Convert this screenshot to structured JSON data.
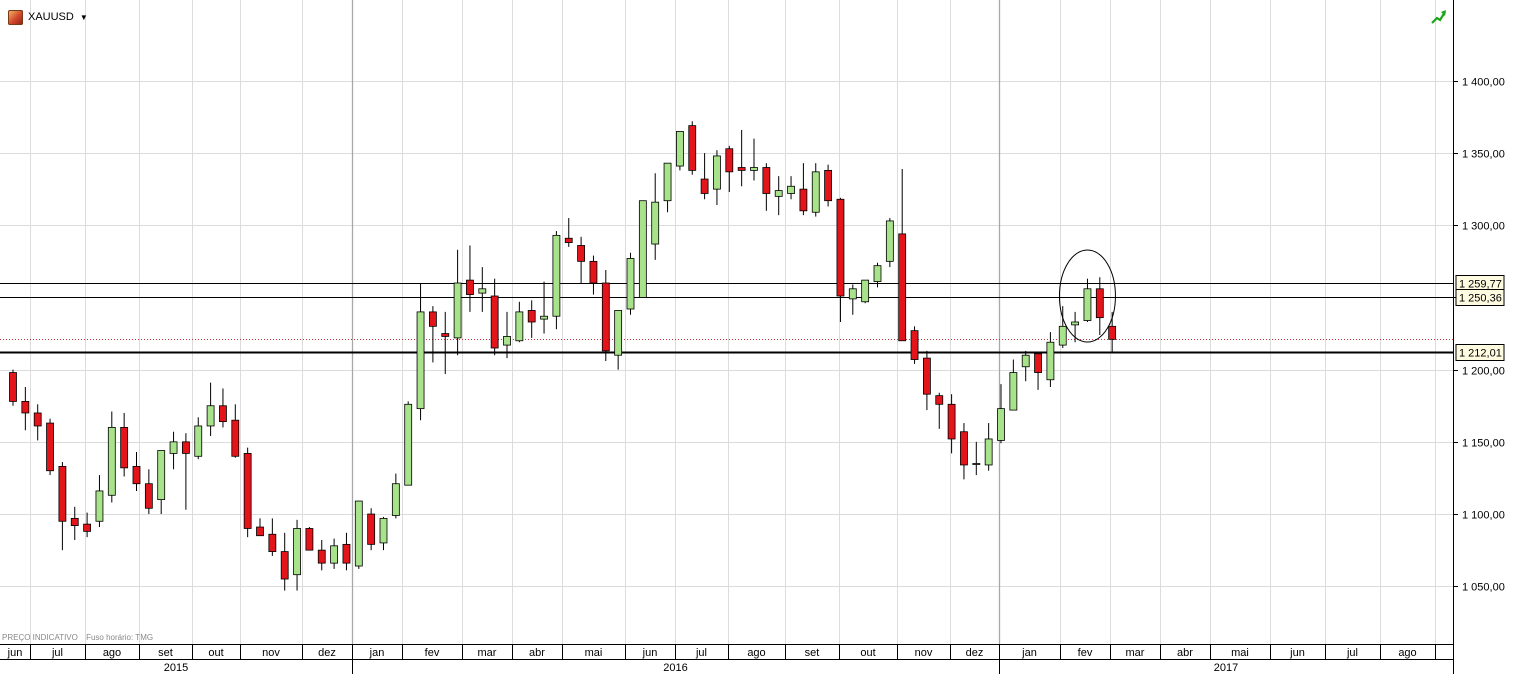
{
  "header": {
    "symbol": "XAUUSD",
    "dropdown_icon": "caret-down-icon",
    "trend_icon": "trend-arrow-icon"
  },
  "footer": {
    "price_note": "PREÇO INDICATIVO",
    "timezone_note": "Fuso horário: TMG"
  },
  "colors": {
    "up": "#a8e28a",
    "down": "#e3151b",
    "outline": "#000000",
    "grid": "#dcdcdc",
    "lastline": "#d03030",
    "highlight": "#000000"
  },
  "chart_data": {
    "type": "candlestick",
    "symbol": "XAUUSD",
    "ylim": [
      1010,
      1456
    ],
    "y_ticks": [
      "1 050,00",
      "1 100,00",
      "1 150,00",
      "1 200,00",
      "1 250,00",
      "1 300,00",
      "1 350,00",
      "1 400,00"
    ],
    "y_tick_values": [
      1050,
      1100,
      1150,
      1200,
      1250,
      1300,
      1350,
      1400
    ],
    "grid": true,
    "horizontal_levels": [
      {
        "value": 1259.77,
        "label": "1 259,77"
      },
      {
        "value": 1250.36,
        "label": "1 250,36"
      },
      {
        "value": 1212.01,
        "label": "1 212,01"
      }
    ],
    "last_price": 1221,
    "annotation": "ellipse around Feb 2017 candles",
    "months": [
      {
        "label": "jun",
        "year": "2015"
      },
      {
        "label": "jul",
        "year": "2015"
      },
      {
        "label": "ago",
        "year": "2015"
      },
      {
        "label": "set",
        "year": "2015"
      },
      {
        "label": "out",
        "year": "2015"
      },
      {
        "label": "nov",
        "year": "2015"
      },
      {
        "label": "dez",
        "year": "2015"
      },
      {
        "label": "jan",
        "year": "2016"
      },
      {
        "label": "fev",
        "year": "2016"
      },
      {
        "label": "mar",
        "year": "2016"
      },
      {
        "label": "abr",
        "year": "2016"
      },
      {
        "label": "mai",
        "year": "2016"
      },
      {
        "label": "jun",
        "year": "2016"
      },
      {
        "label": "jul",
        "year": "2016"
      },
      {
        "label": "ago",
        "year": "2016"
      },
      {
        "label": "set",
        "year": "2016"
      },
      {
        "label": "out",
        "year": "2016"
      },
      {
        "label": "nov",
        "year": "2016"
      },
      {
        "label": "dez",
        "year": "2016"
      },
      {
        "label": "jan",
        "year": "2017"
      },
      {
        "label": "fev",
        "year": "2017"
      },
      {
        "label": "mar",
        "year": "2017"
      },
      {
        "label": "abr",
        "year": "2017"
      },
      {
        "label": "mai",
        "year": "2017"
      },
      {
        "label": "jun",
        "year": "2017"
      },
      {
        "label": "jul",
        "year": "2017"
      },
      {
        "label": "ago",
        "year": "2017"
      }
    ],
    "years": [
      "2015",
      "2016",
      "2017"
    ],
    "candles": [
      [
        1198,
        1200,
        1175,
        1178
      ],
      [
        1178,
        1188,
        1158,
        1170
      ],
      [
        1170,
        1176,
        1151,
        1161
      ],
      [
        1163,
        1166,
        1127,
        1130
      ],
      [
        1133,
        1136,
        1075,
        1095
      ],
      [
        1097,
        1105,
        1082,
        1092
      ],
      [
        1093,
        1101,
        1084,
        1088
      ],
      [
        1095,
        1127,
        1091,
        1116
      ],
      [
        1113,
        1171,
        1108,
        1160
      ],
      [
        1160,
        1170,
        1126,
        1132
      ],
      [
        1133,
        1143,
        1116,
        1121
      ],
      [
        1121,
        1131,
        1100,
        1104
      ],
      [
        1110,
        1144,
        1100,
        1144
      ],
      [
        1142,
        1157,
        1131,
        1150
      ],
      [
        1150,
        1156,
        1103,
        1142
      ],
      [
        1140,
        1167,
        1138,
        1161
      ],
      [
        1161,
        1191,
        1154,
        1175
      ],
      [
        1175,
        1187,
        1160,
        1164
      ],
      [
        1165,
        1176,
        1139,
        1140
      ],
      [
        1142,
        1146,
        1084,
        1090
      ],
      [
        1091,
        1097,
        1085,
        1085
      ],
      [
        1086,
        1097,
        1071,
        1074
      ],
      [
        1074,
        1087,
        1047,
        1055
      ],
      [
        1058,
        1096,
        1047,
        1090
      ],
      [
        1090,
        1091,
        1078,
        1075
      ],
      [
        1075,
        1082,
        1061,
        1066
      ],
      [
        1066,
        1083,
        1062,
        1078
      ],
      [
        1079,
        1087,
        1061,
        1066
      ],
      [
        1064,
        1109,
        1062,
        1109
      ],
      [
        1100,
        1104,
        1075,
        1079
      ],
      [
        1080,
        1098,
        1075,
        1097
      ],
      [
        1099,
        1128,
        1097,
        1121
      ],
      [
        1120,
        1178,
        1120,
        1176
      ],
      [
        1173,
        1260,
        1165,
        1240
      ],
      [
        1240,
        1244,
        1205,
        1230
      ],
      [
        1225,
        1240,
        1197,
        1223
      ],
      [
        1222,
        1283,
        1210,
        1260
      ],
      [
        1262,
        1286,
        1240,
        1252
      ],
      [
        1253,
        1271,
        1240,
        1256
      ],
      [
        1251,
        1263,
        1210,
        1215
      ],
      [
        1217,
        1240,
        1208,
        1223
      ],
      [
        1220,
        1247,
        1219,
        1240
      ],
      [
        1241,
        1248,
        1222,
        1233
      ],
      [
        1235,
        1261,
        1225,
        1237
      ],
      [
        1237,
        1296,
        1228,
        1293
      ],
      [
        1291,
        1305,
        1285,
        1288
      ],
      [
        1286,
        1292,
        1260,
        1275
      ],
      [
        1275,
        1279,
        1252,
        1260
      ],
      [
        1260,
        1269,
        1206,
        1213
      ],
      [
        1210,
        1240,
        1200,
        1241
      ],
      [
        1242,
        1281,
        1238,
        1277
      ],
      [
        1250,
        1316,
        1255,
        1317
      ],
      [
        1287,
        1336,
        1276,
        1316
      ],
      [
        1317,
        1340,
        1309,
        1343
      ],
      [
        1341,
        1364,
        1338,
        1365
      ],
      [
        1369,
        1372,
        1335,
        1338
      ],
      [
        1332,
        1350,
        1318,
        1322
      ],
      [
        1325,
        1352,
        1314,
        1348
      ],
      [
        1353,
        1355,
        1323,
        1337
      ],
      [
        1340,
        1366,
        1327,
        1338
      ],
      [
        1338,
        1360,
        1331,
        1340
      ],
      [
        1340,
        1343,
        1310,
        1322
      ],
      [
        1320,
        1334,
        1307,
        1324
      ],
      [
        1322,
        1334,
        1318,
        1327
      ],
      [
        1325,
        1343,
        1307,
        1310
      ],
      [
        1309,
        1343,
        1306,
        1337
      ],
      [
        1338,
        1342,
        1313,
        1317
      ],
      [
        1318,
        1319,
        1233,
        1251
      ],
      [
        1249,
        1259,
        1238,
        1256
      ],
      [
        1247,
        1262,
        1246,
        1262
      ],
      [
        1261,
        1274,
        1257,
        1272
      ],
      [
        1275,
        1305,
        1271,
        1303
      ],
      [
        1294,
        1339,
        1221,
        1220
      ],
      [
        1227,
        1230,
        1204,
        1207
      ],
      [
        1208,
        1213,
        1172,
        1183
      ],
      [
        1182,
        1184,
        1159,
        1176
      ],
      [
        1176,
        1183,
        1142,
        1152
      ],
      [
        1157,
        1163,
        1124,
        1134
      ],
      [
        1135,
        1150,
        1127,
        1135
      ],
      [
        1134,
        1163,
        1130,
        1152
      ],
      [
        1151,
        1190,
        1149,
        1173
      ],
      [
        1172,
        1207,
        1172,
        1198
      ],
      [
        1202,
        1213,
        1192,
        1210
      ],
      [
        1211,
        1212,
        1186,
        1198
      ],
      [
        1193,
        1226,
        1188,
        1219
      ],
      [
        1217,
        1244,
        1215,
        1230
      ],
      [
        1231,
        1240,
        1219,
        1233
      ],
      [
        1234,
        1263,
        1233,
        1256
      ],
      [
        1256,
        1264,
        1224,
        1236
      ],
      [
        1230,
        1240,
        1212,
        1221
      ]
    ]
  }
}
